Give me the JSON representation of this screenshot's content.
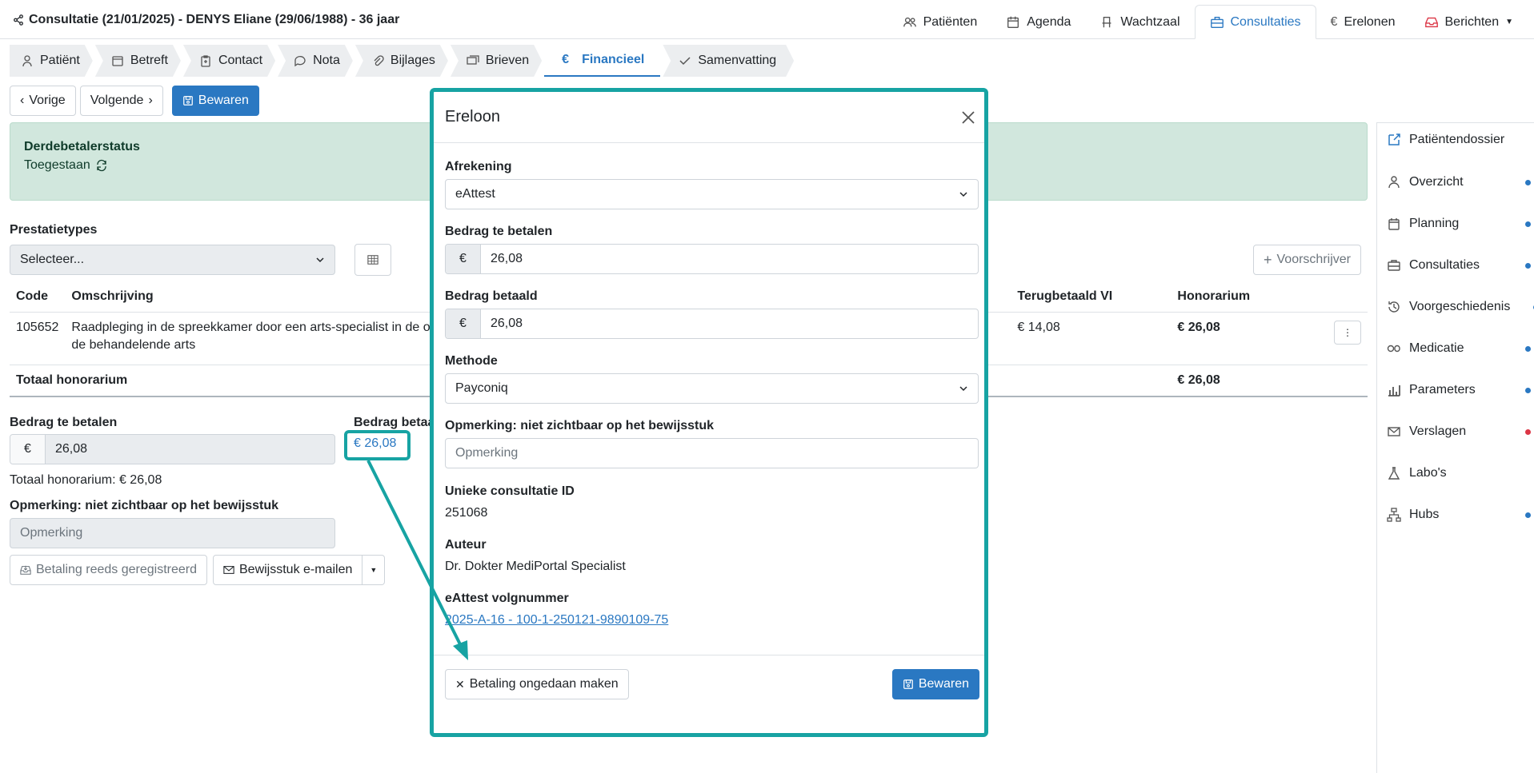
{
  "header": {
    "title": "Consultatie (21/01/2025) - DENYS Eliane (29/06/1988) - 36 jaar",
    "nav": [
      {
        "label": "Patiënten",
        "icon": "users-icon"
      },
      {
        "label": "Agenda",
        "icon": "calendar-icon"
      },
      {
        "label": "Wachtzaal",
        "icon": "chair-icon"
      },
      {
        "label": "Consultaties",
        "icon": "briefcase-icon",
        "active": true
      },
      {
        "label": "Erelonen",
        "icon": "euro-icon"
      },
      {
        "label": "Berichten",
        "icon": "inbox-icon"
      }
    ]
  },
  "subtabs": [
    {
      "label": "Patiënt",
      "icon": "person-icon"
    },
    {
      "label": "Betreft",
      "icon": "calendar-icon"
    },
    {
      "label": "Contact",
      "icon": "clipboard-icon"
    },
    {
      "label": "Nota",
      "icon": "chat-icon"
    },
    {
      "label": "Bijlages",
      "icon": "paperclip-icon"
    },
    {
      "label": "Brieven",
      "icon": "letters-icon"
    },
    {
      "label": "Financieel",
      "icon": "euro-icon",
      "active": true
    },
    {
      "label": "Samenvatting",
      "icon": "check-icon"
    }
  ],
  "actions": {
    "prev": "Vorige",
    "next": "Volgende",
    "save": "Bewaren"
  },
  "alert": {
    "title": "Derdebetalerstatus",
    "value": "Toegestaan"
  },
  "prestatie": {
    "label": "Prestatietypes",
    "select": "Selecteer...",
    "voorschrijver": "Voorschrijver"
  },
  "table": {
    "headers": {
      "code": "Code",
      "omschrijving": "Omschrijving",
      "terug": "Terugbetaald VI",
      "honorarium": "Honorarium"
    },
    "row": {
      "code": "105652",
      "omschrijving_1": "Raadpleging in de spreekkamer door een arts-specialist in de or",
      "omschrijving_2": "de behandelende arts",
      "terug": "€ 14,08",
      "honorarium": "€ 26,08"
    },
    "total_label": "Totaal honorarium",
    "total_value": "€ 26,08"
  },
  "payment": {
    "te_betalen_label": "Bedrag te betalen",
    "te_betalen": "26,08",
    "betaald_label": "Bedrag betaa",
    "betaald_link": "€ 26,08",
    "totaal": "Totaal honorarium: € 26,08",
    "opmerking_label": "Opmerking: niet zichtbaar op het bewijsstuk",
    "opmerking_placeholder": "Opmerking",
    "btn_registered": "Betaling reeds geregistreerd",
    "btn_mail": "Bewijsstuk e-mailen"
  },
  "sidebar": [
    {
      "label": "Patiëntendossier",
      "icon": "external-edit-icon",
      "dot": null
    },
    {
      "label": "Overzicht",
      "icon": "person-icon",
      "dot": "#2a78c2"
    },
    {
      "label": "Planning",
      "icon": "calendar-icon",
      "dot": "#2a78c2"
    },
    {
      "label": "Consultaties",
      "icon": "briefcase-icon",
      "dot": "#2a78c2"
    },
    {
      "label": "Voorgeschiedenis",
      "icon": "history-icon",
      "dot": "#2a78c2"
    },
    {
      "label": "Medicatie",
      "icon": "pills-icon",
      "dot": "#2a78c2"
    },
    {
      "label": "Parameters",
      "icon": "chart-icon",
      "dot": "#2a78c2"
    },
    {
      "label": "Verslagen",
      "icon": "envelope-icon",
      "dot": "#dc3545"
    },
    {
      "label": "Labo's",
      "icon": "flask-icon",
      "dot": null
    },
    {
      "label": "Hubs",
      "icon": "network-icon",
      "dot": "#2a78c2"
    }
  ],
  "modal": {
    "title": "Ereloon",
    "afrekening_label": "Afrekening",
    "afrekening": "eAttest",
    "te_betalen_label": "Bedrag te betalen",
    "te_betalen": "26,08",
    "betaald_label": "Bedrag betaald",
    "betaald": "26,08",
    "methode_label": "Methode",
    "methode": "Payconiq",
    "opmerking_label": "Opmerking: niet zichtbaar op het bewijsstuk",
    "opmerking_placeholder": "Opmerking",
    "id_label": "Unieke consultatie ID",
    "id": "251068",
    "auteur_label": "Auteur",
    "auteur": "Dr. Dokter MediPortal Specialist",
    "volgnummer_label": "eAttest volgnummer",
    "volgnummer": "2025-A-16 - 100-1-250121-9890109-75",
    "undo": "Betaling ongedaan maken",
    "save": "Bewaren"
  },
  "colors": {
    "accent": "#2a78c2",
    "highlight": "#17a3a3",
    "alert_bg": "#d1e7dd"
  }
}
